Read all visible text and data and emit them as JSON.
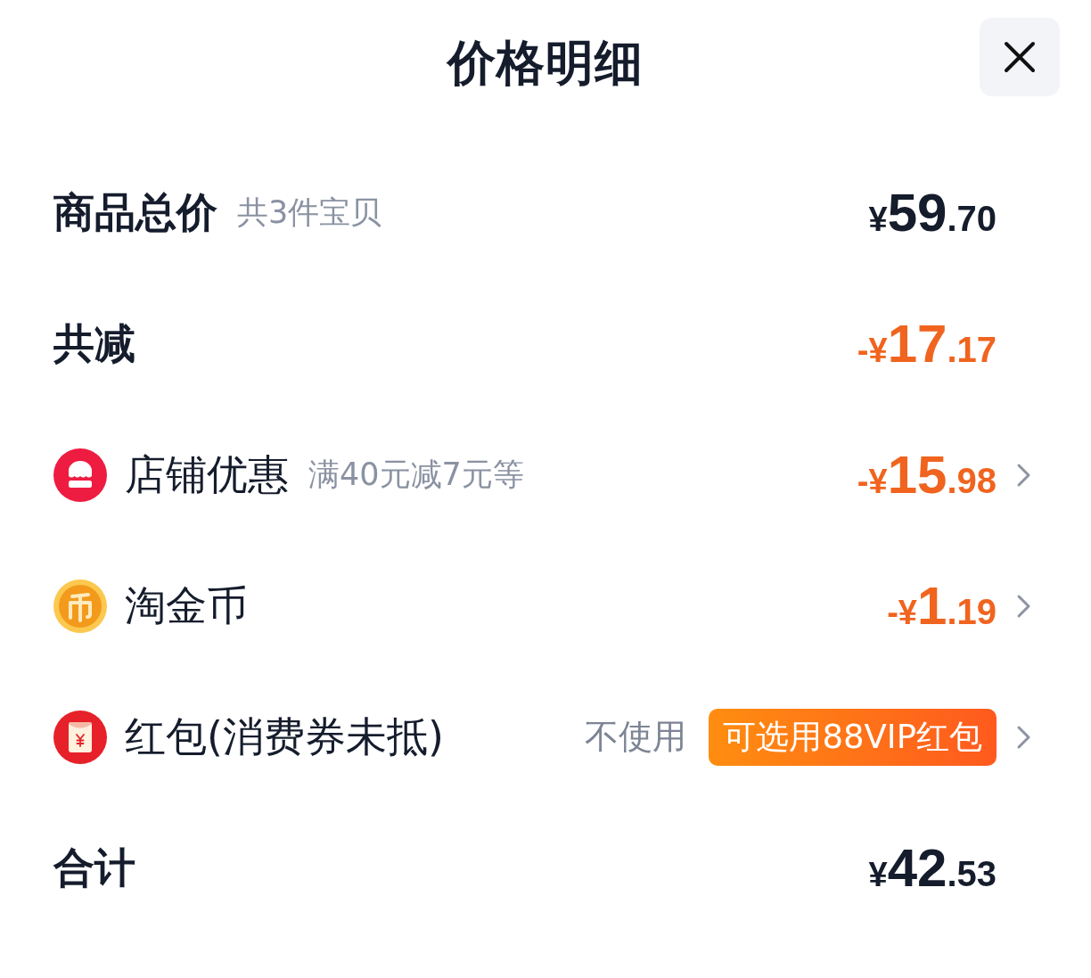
{
  "title": "价格明细",
  "rows": [
    {
      "kind": "subtotal",
      "label": "商品总价",
      "note": "共3件宝贝",
      "amount": {
        "prefix": "¥",
        "integer": "59",
        "decimal": ".70"
      }
    },
    {
      "kind": "saving",
      "label": "共减",
      "amount": {
        "prefix": "-¥",
        "integer": "17",
        "decimal": ".17"
      }
    },
    {
      "kind": "store",
      "label": "店铺优惠",
      "note": "满40元减7元等",
      "amount": {
        "prefix": "-¥",
        "integer": "15",
        "decimal": ".98"
      }
    },
    {
      "kind": "coin",
      "label": "淘金币",
      "amount": {
        "prefix": "-¥",
        "integer": "1",
        "decimal": ".19"
      }
    },
    {
      "kind": "envelope",
      "label": "红包(消费券未抵)",
      "option": "不使用",
      "badge": "可选用88VIP红包"
    },
    {
      "kind": "total",
      "label": "合计",
      "amount": {
        "prefix": "¥",
        "integer": "42",
        "decimal": ".53"
      }
    }
  ]
}
